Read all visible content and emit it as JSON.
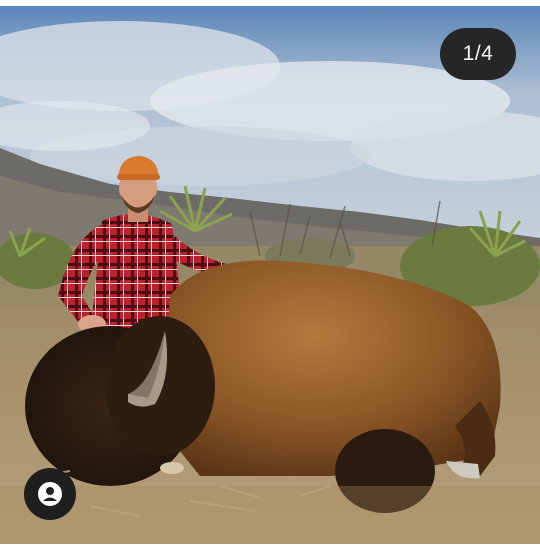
{
  "viewer": {
    "counter": "1/4",
    "tags_icon": "user-tag-icon"
  },
  "colors": {
    "sky": "#9fb1c6",
    "grass": "#a98f66",
    "bison_fur": "#8a5a2f",
    "shirt": "#b8232f",
    "counter_bg": "#262626",
    "counter_text": "#f5f5f5"
  }
}
